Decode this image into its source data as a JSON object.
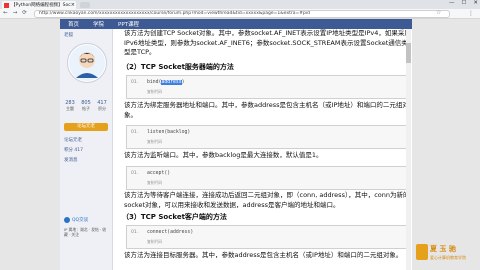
{
  "browser": {
    "tab_title": "【Python网络编程视频】Soc",
    "url": "http://www.cnkaoyan.com/xxxxxxxxxxxxxxxxxxx/course/forum.php?mod=viewthread&tid=xxxxx&page=1&extra=#pid",
    "nav_back": "←",
    "nav_forward": "→",
    "nav_reload": "⟳",
    "win_min": "—",
    "win_max": "☐",
    "win_close": "✕"
  },
  "sitenav": {
    "items": [
      "首页",
      "学院",
      "PPT课程"
    ]
  },
  "sidebar": {
    "username": "老狐",
    "stats": [
      {
        "num": "283",
        "label": "主题"
      },
      {
        "num": "805",
        "label": "帖子"
      },
      {
        "num": "417",
        "label": "积分"
      }
    ],
    "badge": "论坛元老",
    "labels": [
      "论坛元老",
      "积分 417",
      "发消息"
    ],
    "qq": "QQ交谈",
    "footer": "IP 属地：湖北 · 发帖 · 收藏 · 关注"
  },
  "content": {
    "p1": "该方法为创建TCP Socket对象。其中，参数socket.AF_INET表示设置IP地址类型是IPv4，如果采用IPv6地址类型，则参数为socket.AF_INET6；参数socket.SOCK_STREAM表示设置Socket通信类型是TCP。",
    "h2": "（2）TCP Socket服务器端的方法",
    "code1_ln": "01.",
    "code1_a": "bind(",
    "code1_b": "address",
    "code1_c": ")",
    "copy": "复制代码",
    "p2": "该方法为绑定服务器地址和端口。其中，参数address是包含主机名（或IP地址）和端口的二元组对象。",
    "code2": "listen(backlog)",
    "p3": "该方法为监听端口。其中，参数backlog是最大连接数，默认值是1。",
    "code3": "accept()",
    "p4": "该方法为等待客户端连接，连接成功后返回二元组对象，即（conn, address），其中，conn为新的socket对象，可以用来接收和发送数据，address是客户端的地址和端口。",
    "h3": "（3）TCP Socket客户端的方法",
    "code4": "connect(address)",
    "p5": "该方法为连接目标服务器。其中，参数address是包含主机名（或IP地址）和端口的二元组对象。"
  },
  "logo": {
    "t1": "夏 玉 驰",
    "t2": "爱心计算机教育学院"
  }
}
